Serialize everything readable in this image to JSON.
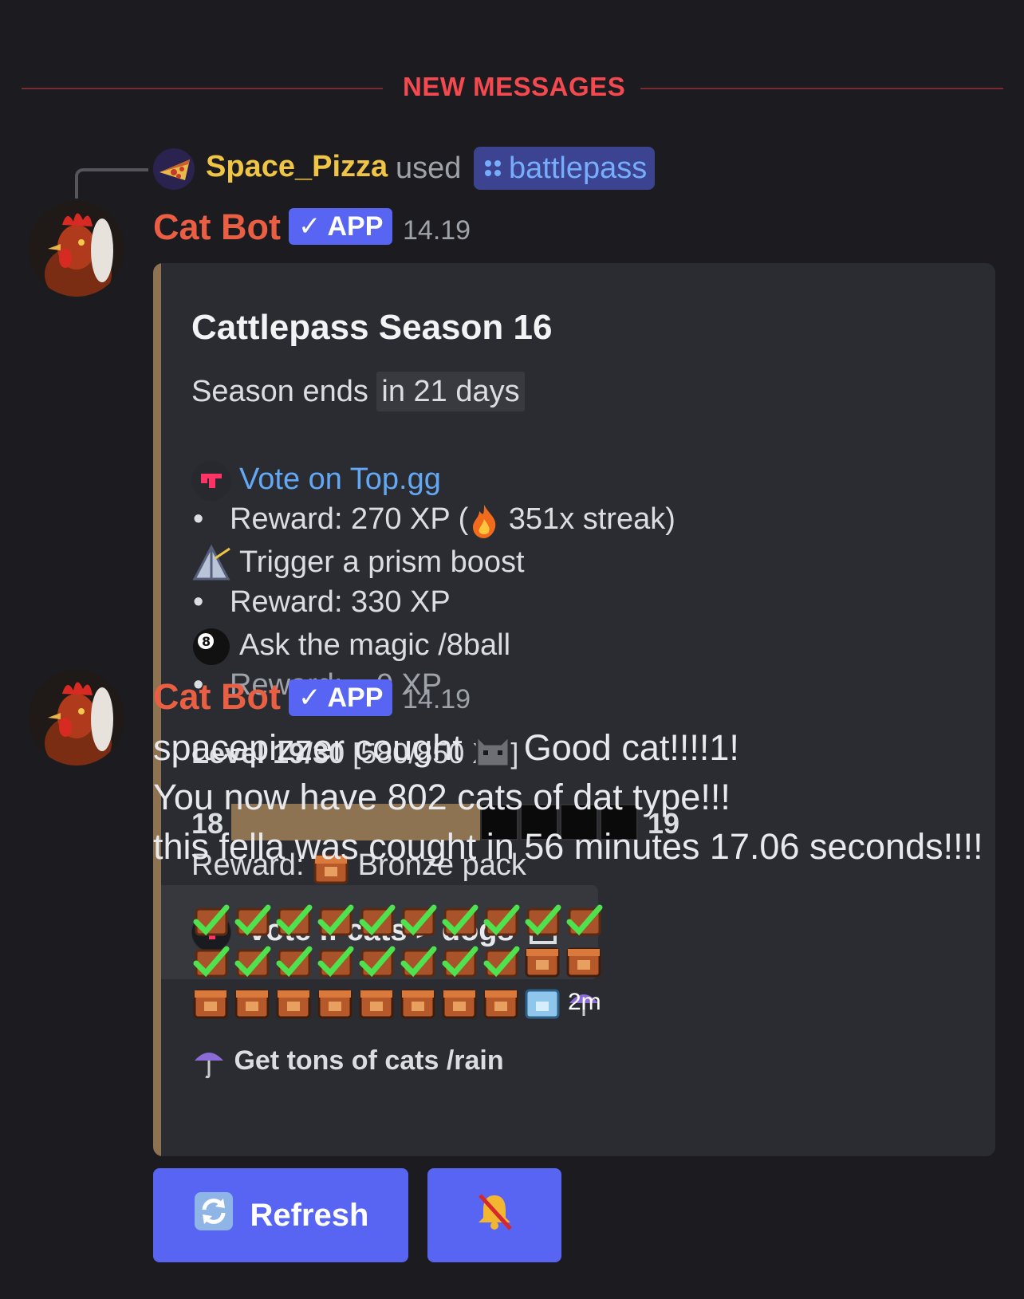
{
  "divider": {
    "label": "NEW MESSAGES"
  },
  "reply": {
    "username": "Space_Pizza",
    "used_text": "used",
    "command": "battlepass"
  },
  "message1": {
    "bot_name": "Cat Bot",
    "badge": "APP",
    "time": "14.19"
  },
  "embed": {
    "title": "Cattlepass Season 16",
    "season_prefix": "Season ends ",
    "season_highlight": "in 21 days",
    "tasks": [
      {
        "icon": "topgg-icon",
        "label": "Vote on Top.gg",
        "reward_prefix": "Reward: 270 XP (",
        "reward_suffix": " 351x streak)"
      },
      {
        "icon": "prism-icon",
        "label": "Trigger a prism boost",
        "reward": "Reward: 330 XP"
      },
      {
        "icon": "8ball-icon",
        "label": "Ask the magic /8ball",
        "reward": "Reward: ...0 XP"
      }
    ],
    "level_label": "Level 19/30",
    "level_xp": " [580/850 XP]",
    "level_from": "18",
    "level_to": "19",
    "progress": 0.68,
    "level_reward_prefix": "Reward: ",
    "level_reward_suffix": " Bronze pack",
    "vote_button": "vote if cats > dogs",
    "rain_timer": "2m",
    "rain_text": "Get tons of cats /rain"
  },
  "message2": {
    "bot_name": "Cat Bot",
    "badge": "APP",
    "time": "14.19",
    "line1_prefix": "spacepizzer cought ",
    "line1_suffix": " Good cat!!!!1!",
    "line2": "You now have 802 cats of dat type!!!",
    "line3": "this fella was cought in 56 minutes 17.06 seconds!!!!"
  },
  "buttons": {
    "refresh": "Refresh"
  },
  "colors": {
    "background": "#1c1c20",
    "divider": "#f3494f",
    "embed_accent": "#8e7352",
    "blurple": "#5865f2",
    "link": "#63a8f5",
    "username": "#f0c545",
    "bot_name": "#ea5f43"
  }
}
